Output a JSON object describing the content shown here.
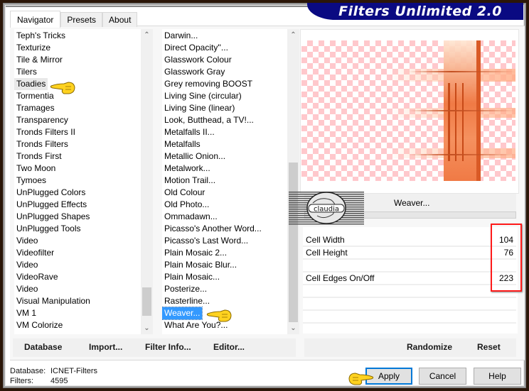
{
  "window": {
    "title": "Filters Unlimited 2.0"
  },
  "tabs": [
    {
      "label": "Navigator",
      "active": true
    },
    {
      "label": "Presets",
      "active": false
    },
    {
      "label": "About",
      "active": false
    }
  ],
  "categories": {
    "items": [
      "Teph's Tricks",
      "Texturize",
      "Tile & Mirror",
      "Tilers",
      "Toadies",
      "Tormentia",
      "Tramages",
      "Transparency",
      "Tronds Filters II",
      "Tronds Filters",
      "Tronds First",
      "Two Moon",
      "Tymoes",
      "UnPlugged Colors",
      "UnPlugged Effects",
      "UnPlugged Shapes",
      "UnPlugged Tools",
      "Video",
      "Videofilter",
      "Video",
      "VideoRave",
      "Video",
      "Visual Manipulation",
      "VM 1",
      "VM Colorize"
    ],
    "highlighted": "Toadies"
  },
  "filters": {
    "items": [
      "Darwin...",
      "Direct Opacity''...",
      "Glasswork Colour",
      "Glasswork Gray",
      "Grey removing BOOST",
      "Living Sine (circular)",
      "Living Sine (linear)",
      "Look, Butthead, a TV!...",
      "Metalfalls II...",
      "Metalfalls",
      "Metallic Onion...",
      "Metalwork...",
      "Motion Trail...",
      "Old Colour",
      "Old Photo...",
      "Ommadawn...",
      "Picasso's Another Word...",
      "Picasso's Last Word...",
      "Plain Mosaic 2...",
      "Plain Mosaic Blur...",
      "Plain Mosaic...",
      "Posterize...",
      "Rasterline...",
      "Weaver...",
      "What Are You?..."
    ],
    "selected": "Weaver..."
  },
  "preview": {
    "filter_name": "Weaver...",
    "accent_color": "#f07a45"
  },
  "logo": {
    "text": "claudia"
  },
  "parameters": [
    {
      "label": "Cell Width",
      "value": "104"
    },
    {
      "label": "Cell Height",
      "value": "76"
    },
    {
      "label": "Cell Edges On/Off",
      "value": "223"
    }
  ],
  "left_buttons": {
    "database": "Database",
    "import": "Import...",
    "filter_info": "Filter Info...",
    "editor": "Editor..."
  },
  "right_buttons": {
    "randomize": "Randomize",
    "reset": "Reset"
  },
  "status": {
    "database_label": "Database:",
    "database_value": "ICNET-Filters",
    "filters_label": "Filters:",
    "filters_value": "4595"
  },
  "dialog_buttons": {
    "apply": "Apply",
    "cancel": "Cancel",
    "help": "Help"
  }
}
